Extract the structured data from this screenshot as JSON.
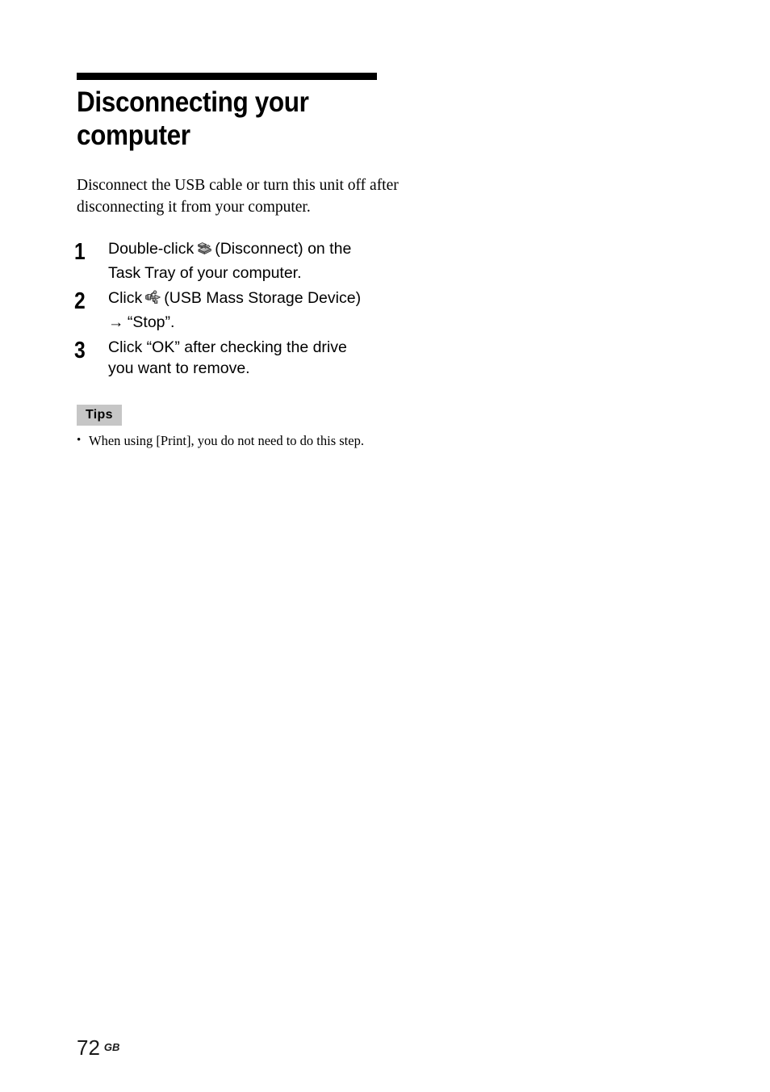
{
  "document": {
    "title_line_1": "Disconnecting your",
    "title_line_2": "computer",
    "title_full": "Disconnecting your\ncomputer",
    "intro": "Disconnect the USB cable or turn this unit off after disconnecting it from your computer."
  },
  "steps": [
    {
      "number": "1",
      "text_before_icon": "Double-click",
      "icon": "disconnect-tray-icon",
      "text_after_icon": "(Disconnect) on the Task Tray of your computer.",
      "full_text": "Double-click  (Disconnect) on the Task Tray of your computer."
    },
    {
      "number": "2",
      "text_before_icon": "Click",
      "icon": "usb-mass-storage-icon",
      "text_after_icon": "(USB Mass Storage Device)",
      "arrow": "→",
      "text_tail": "“Stop”.",
      "full_text": "Click  (USB Mass Storage Device) → “Stop”."
    },
    {
      "number": "3",
      "text_before_icon": "",
      "icon": null,
      "text_after_icon": "",
      "full_text": "Click “OK” after checking the drive you want to remove."
    }
  ],
  "tips": {
    "badge_label": "Tips",
    "badge_bg_color": "#c6c6c6",
    "items": [
      {
        "bullet": "•",
        "text": "When using [Print], you do not need to do this step."
      }
    ]
  },
  "footer": {
    "page_number": "72",
    "region_code": "GB"
  },
  "colors": {
    "page_background": "#ffffff",
    "text": "#000000",
    "rule": "#000000",
    "tips_badge": "#c6c6c6",
    "folio": "#1a1a1a"
  }
}
